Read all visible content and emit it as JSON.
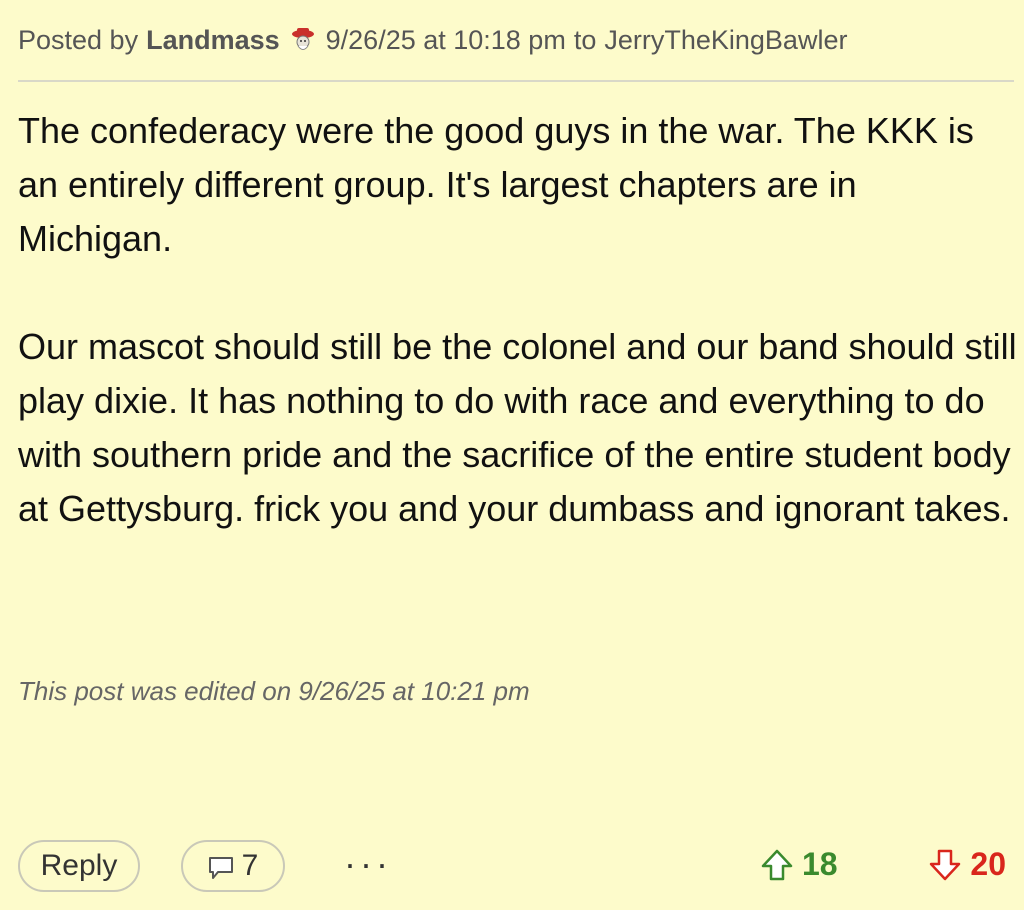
{
  "header": {
    "posted_by_label": "Posted by",
    "author": "Landmass",
    "author_badge_icon": "rebel-mascot-icon",
    "date": "9/26/25 at 10:18 pm",
    "to_label": "to",
    "recipient": "JerryTheKingBawler"
  },
  "post": {
    "paragraph_1": "The confederacy were the good guys in the war. The KKK is an entirely different group. It's largest chapters are in Michigan.",
    "paragraph_2": "Our mascot should still be the colonel and our band should still play dixie. It has nothing to do with race and everything to do with southern pride and the sacrifice of the entire student body at Gettysburg. frick you and your dumbass and ignorant takes."
  },
  "edited_note": "This post was edited on 9/26/25 at 10:21 pm",
  "actions": {
    "reply_label": "Reply",
    "replies_icon": "speech-bubble-icon",
    "replies_count": "7",
    "more_label": "···",
    "upvote_icon": "up-arrow-icon",
    "upvote_count": "18",
    "downvote_icon": "down-arrow-icon",
    "downvote_count": "20"
  },
  "colors": {
    "background": "#fdfbcb",
    "upvote": "#3a8a2e",
    "downvote": "#d9261c"
  }
}
